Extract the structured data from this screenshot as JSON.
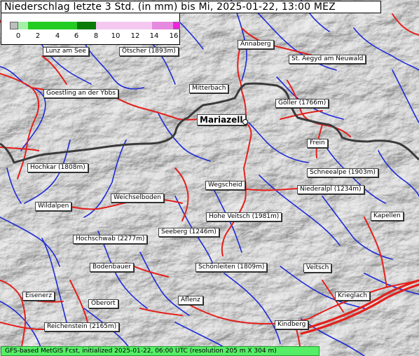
{
  "title": "Niederschlag letzte 3 Std. (in mm) bis Mi, 2025-01-22, 13:00 MEZ",
  "legend": {
    "ticks": [
      "0",
      "2",
      "4",
      "6",
      "8",
      "10",
      "12",
      "14",
      "16"
    ],
    "colors": {
      "none": "#bdbdbd",
      "light_green": "#a6f0a6",
      "green": "#22cc22",
      "dark_green": "#0a7a0a",
      "light_pink": "#f4c8f0",
      "pink": "#e68ae0",
      "magenta": "#ee22dd"
    }
  },
  "places": {
    "lunz": "Lunz am See",
    "oetscher": "Ötscher (1893m)",
    "annaberg": "Annaberg",
    "aegyd": "St. Aegyd am Neuwald",
    "goestling": "Goestling an der Ybbs",
    "mitterbach": "Mitterbach",
    "goeller": "Göller (1766m)",
    "mariazell": "Mariazell",
    "frein": "Frein",
    "hochkar": "Hochkar (1808m)",
    "schneealpe": "Schneealpe (1903m)",
    "wegscheid": "Wegscheid",
    "niederalpl": "Niederalpl (1234m)",
    "weichselboden": "Weichselboden",
    "wildalpen": "Wildalpen",
    "hoheveitsch": "Hohe Veitsch (1981m)",
    "kapellen": "Kapellen",
    "seeberg": "Seeberg (1246m)",
    "hochschwab": "Hochschwab (2277m)",
    "bodenbauer": "Bodenbauer",
    "schoenleiten": "Schönleiten (1809m)",
    "veitsch": "Veitsch",
    "eisenerz": "Eisenerz",
    "oberort": "Oberort",
    "aflenz": "Aflenz",
    "krieglach": "Krieglach",
    "reichenstein": "Reichenstein (2165m)",
    "kindberg": "Kindberg"
  },
  "footer": "GFS-based MetGIS Fcst, initialized 2025-01-22, 06:00 UTC  (resolution 205 m X 304 m)"
}
